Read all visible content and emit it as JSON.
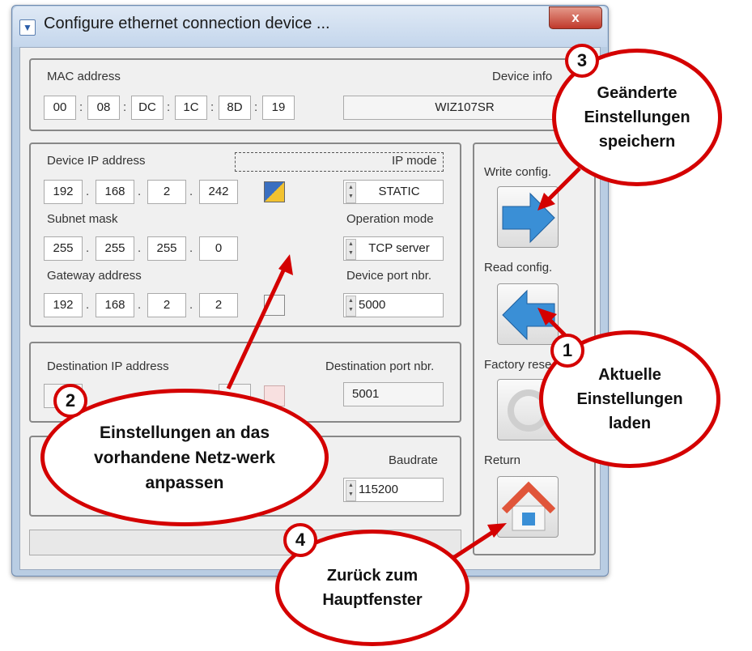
{
  "window": {
    "title": "Configure ethernet connection device ...",
    "close_label": "x"
  },
  "mac": {
    "label": "MAC address",
    "octets": [
      "00",
      "08",
      "DC",
      "1C",
      "8D",
      "19"
    ],
    "separator": ":",
    "device_info_label": "Device info",
    "device_info_value": "WIZ107SR"
  },
  "network": {
    "device_ip_label": "Device IP address",
    "device_ip": [
      "192",
      "168",
      "2",
      "242"
    ],
    "subnet_label": "Subnet mask",
    "subnet": [
      "255",
      "255",
      "255",
      "0"
    ],
    "gateway_label": "Gateway address",
    "gateway": [
      "192",
      "168",
      "2",
      "2"
    ],
    "separator": ".",
    "ip_mode_label": "IP mode",
    "ip_mode_value": "STATIC",
    "operation_mode_label": "Operation mode",
    "operation_mode_value": "TCP server",
    "device_port_label": "Device port nbr.",
    "device_port_value": "5000"
  },
  "destination": {
    "ip_label": "Destination IP address",
    "port_label": "Destination port nbr.",
    "port_value": "5001"
  },
  "serial": {
    "baudrate_label": "Baudrate",
    "baudrate_value": "115200"
  },
  "actions": {
    "write_label": "Write config.",
    "read_label": "Read config.",
    "factory_label": "Factory rese",
    "return_label": "Return"
  },
  "callouts": {
    "c1": {
      "number": "1",
      "text": "Aktuelle Einstellungen laden"
    },
    "c2": {
      "number": "2",
      "text": "Einstellungen an das vorhandene Netz-werk anpassen"
    },
    "c3": {
      "number": "3",
      "text": "Geänderte Einstellungen speichern"
    },
    "c4": {
      "number": "4",
      "text": "Zurück zum Hauptfenster"
    }
  },
  "colors": {
    "callout_red": "#d40000",
    "arrow_blue": "#3a8fd6",
    "home_orange": "#e0553a"
  },
  "icons": {
    "write": "arrow-right-icon",
    "read": "arrow-left-icon",
    "factory": "reset-icon",
    "return": "home-icon",
    "wizard": "wand-icon"
  }
}
